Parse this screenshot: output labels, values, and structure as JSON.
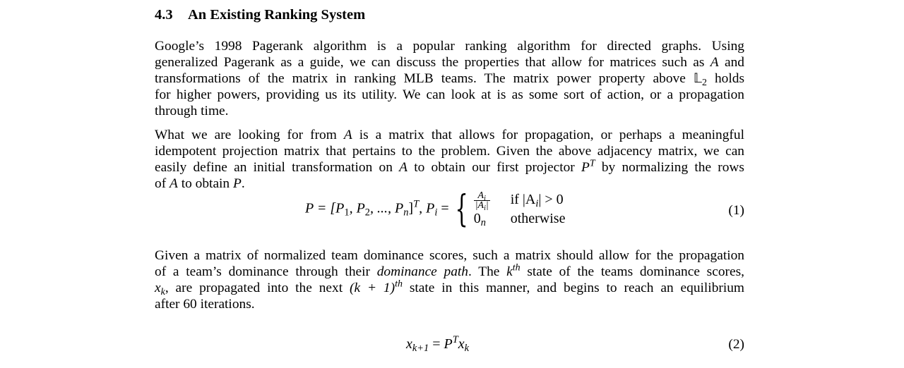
{
  "section": {
    "number": "4.3",
    "title": "An Existing Ranking System"
  },
  "p1": {
    "l1": "Google’s 1998 Pagerank algorithm is a popular ranking algorithm for directed graphs.  Using",
    "l2a": "generalized Pagerank as a guide, we can discuss the properties that allow for matrices such as",
    "l2b": "and",
    "l3a": "transformations of the matrix in ranking MLB teams. The matrix power property above",
    "l3b": "holds",
    "l4": "for higher powers, providing us its utility. We can look at is as some sort of action, or a propagation",
    "l5": "through time."
  },
  "p2": {
    "l1a": "What we are looking for from",
    "l1b": "is a matrix that allows for propagation, or perhaps a meaningful",
    "l2": "idempotent projection matrix that pertains to the problem. Given the above adjacency matrix, we can",
    "l3a": "easily define an initial transformation on",
    "l3b": "to obtain our first projector",
    "l3c": "by normalizing the rows",
    "l4a": "of",
    "l4b": "to obtain"
  },
  "eq1": {
    "lhs": "P = [P",
    "sub1": "1",
    "mid1": ", P",
    "sub2": "2",
    "mid2": ", ..., P",
    "subn": "n",
    "rb": "]",
    "supT": "T",
    "pi": ", P",
    "subi": "i",
    "eqs": " =",
    "frac_num": "A",
    "frac_num_sub": "i",
    "frac_den": "|A",
    "frac_den_sub": "i",
    "frac_den_end": "|",
    "cond1": "if |A",
    "cond1_sub": "i",
    "cond1_end": "| > 0",
    "zero": "0",
    "zero_sub": "n",
    "cond2": "otherwise",
    "number": "(1)"
  },
  "p3": {
    "l1": "Given a matrix of normalized team dominance scores, such a matrix should allow for the propagation",
    "l2a": "of a team’s dominance through their",
    "l2b": "dominance path",
    "l2c": ". The",
    "l2d": "state of the teams dominance scores,",
    "l3a": ", are propagated into the next",
    "l3b": "state in this manner, and begins to reach an equilibrium",
    "l4": "after 60 iterations."
  },
  "eq2": {
    "x": "x",
    "sub_lhs": "k+1",
    "eq": " = ",
    "P": "P",
    "supT": "T",
    "x2": "x",
    "sub_rhs": "k",
    "number": "(2)"
  },
  "sym": {
    "A": "A",
    "P": "P",
    "PT_base": "P",
    "PT_sup": "T",
    "L": "𝕃",
    "L_sub": "2",
    "k": "k",
    "th": "th",
    "xk": "x",
    "xk_sub": "k",
    "k1": "(k + 1)",
    "dot": "."
  }
}
